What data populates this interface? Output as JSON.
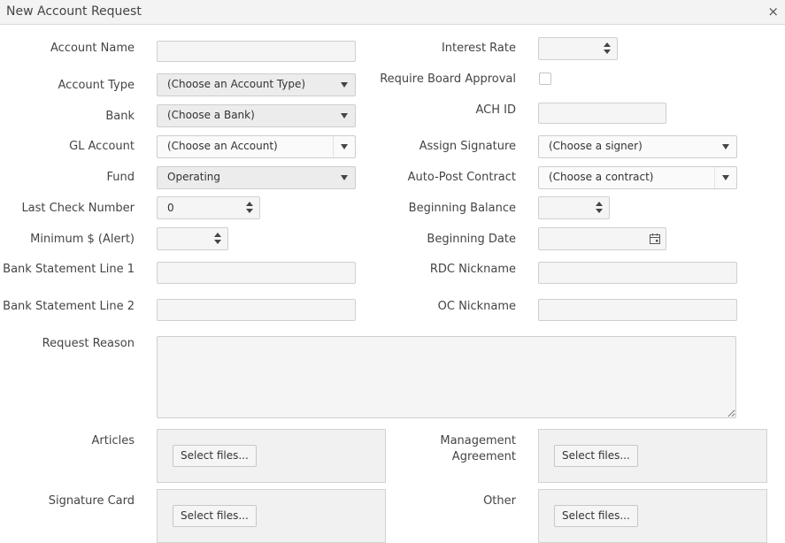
{
  "dialog": {
    "title": "New Account Request",
    "close_glyph": "×"
  },
  "fields": {
    "account_name": {
      "label": "Account Name",
      "value": ""
    },
    "account_type": {
      "label": "Account Type",
      "value": "(Choose an Account Type)"
    },
    "bank": {
      "label": "Bank",
      "value": "(Choose a Bank)"
    },
    "gl_account": {
      "label": "GL Account",
      "value": "(Choose an Account)"
    },
    "fund": {
      "label": "Fund",
      "value": "Operating"
    },
    "last_check_number": {
      "label": "Last Check Number",
      "value": "0"
    },
    "minimum_alert": {
      "label": "Minimum $ (Alert)",
      "value": ""
    },
    "bank_statement_line_1": {
      "label": "Bank Statement Line 1",
      "value": ""
    },
    "bank_statement_line_2": {
      "label": "Bank Statement Line 2",
      "value": ""
    },
    "request_reason": {
      "label": "Request Reason",
      "value": ""
    },
    "interest_rate": {
      "label": "Interest Rate",
      "value": ""
    },
    "require_board_approval": {
      "label": "Require Board Approval",
      "checked": false
    },
    "ach_id": {
      "label": "ACH ID",
      "value": ""
    },
    "assign_signature": {
      "label": "Assign Signature",
      "value": "(Choose a signer)"
    },
    "auto_post_contract": {
      "label": "Auto-Post Contract",
      "value": "(Choose a contract)"
    },
    "beginning_balance": {
      "label": "Beginning Balance",
      "value": ""
    },
    "beginning_date": {
      "label": "Beginning Date",
      "value": ""
    },
    "rdc_nickname": {
      "label": "RDC Nickname",
      "value": ""
    },
    "oc_nickname": {
      "label": "OC Nickname",
      "value": ""
    }
  },
  "uploads": {
    "articles": {
      "label": "Articles",
      "button": "Select files..."
    },
    "management_agreement": {
      "label_line1": "Management",
      "label_line2": "Agreement",
      "button": "Select files..."
    },
    "signature_card": {
      "label": "Signature Card",
      "button": "Select files..."
    },
    "other": {
      "label": "Other",
      "button": "Select files..."
    }
  },
  "icons": {
    "dropdown": "caret-down-icon",
    "spinner": "spinner-arrows-icon",
    "calendar": "calendar-icon",
    "close": "close-icon"
  },
  "colors": {
    "field_bg": "#f5f5f5",
    "select_bg": "#ececec",
    "border": "#cfcfcf",
    "titlebar_bg": "#f3f3f3"
  }
}
